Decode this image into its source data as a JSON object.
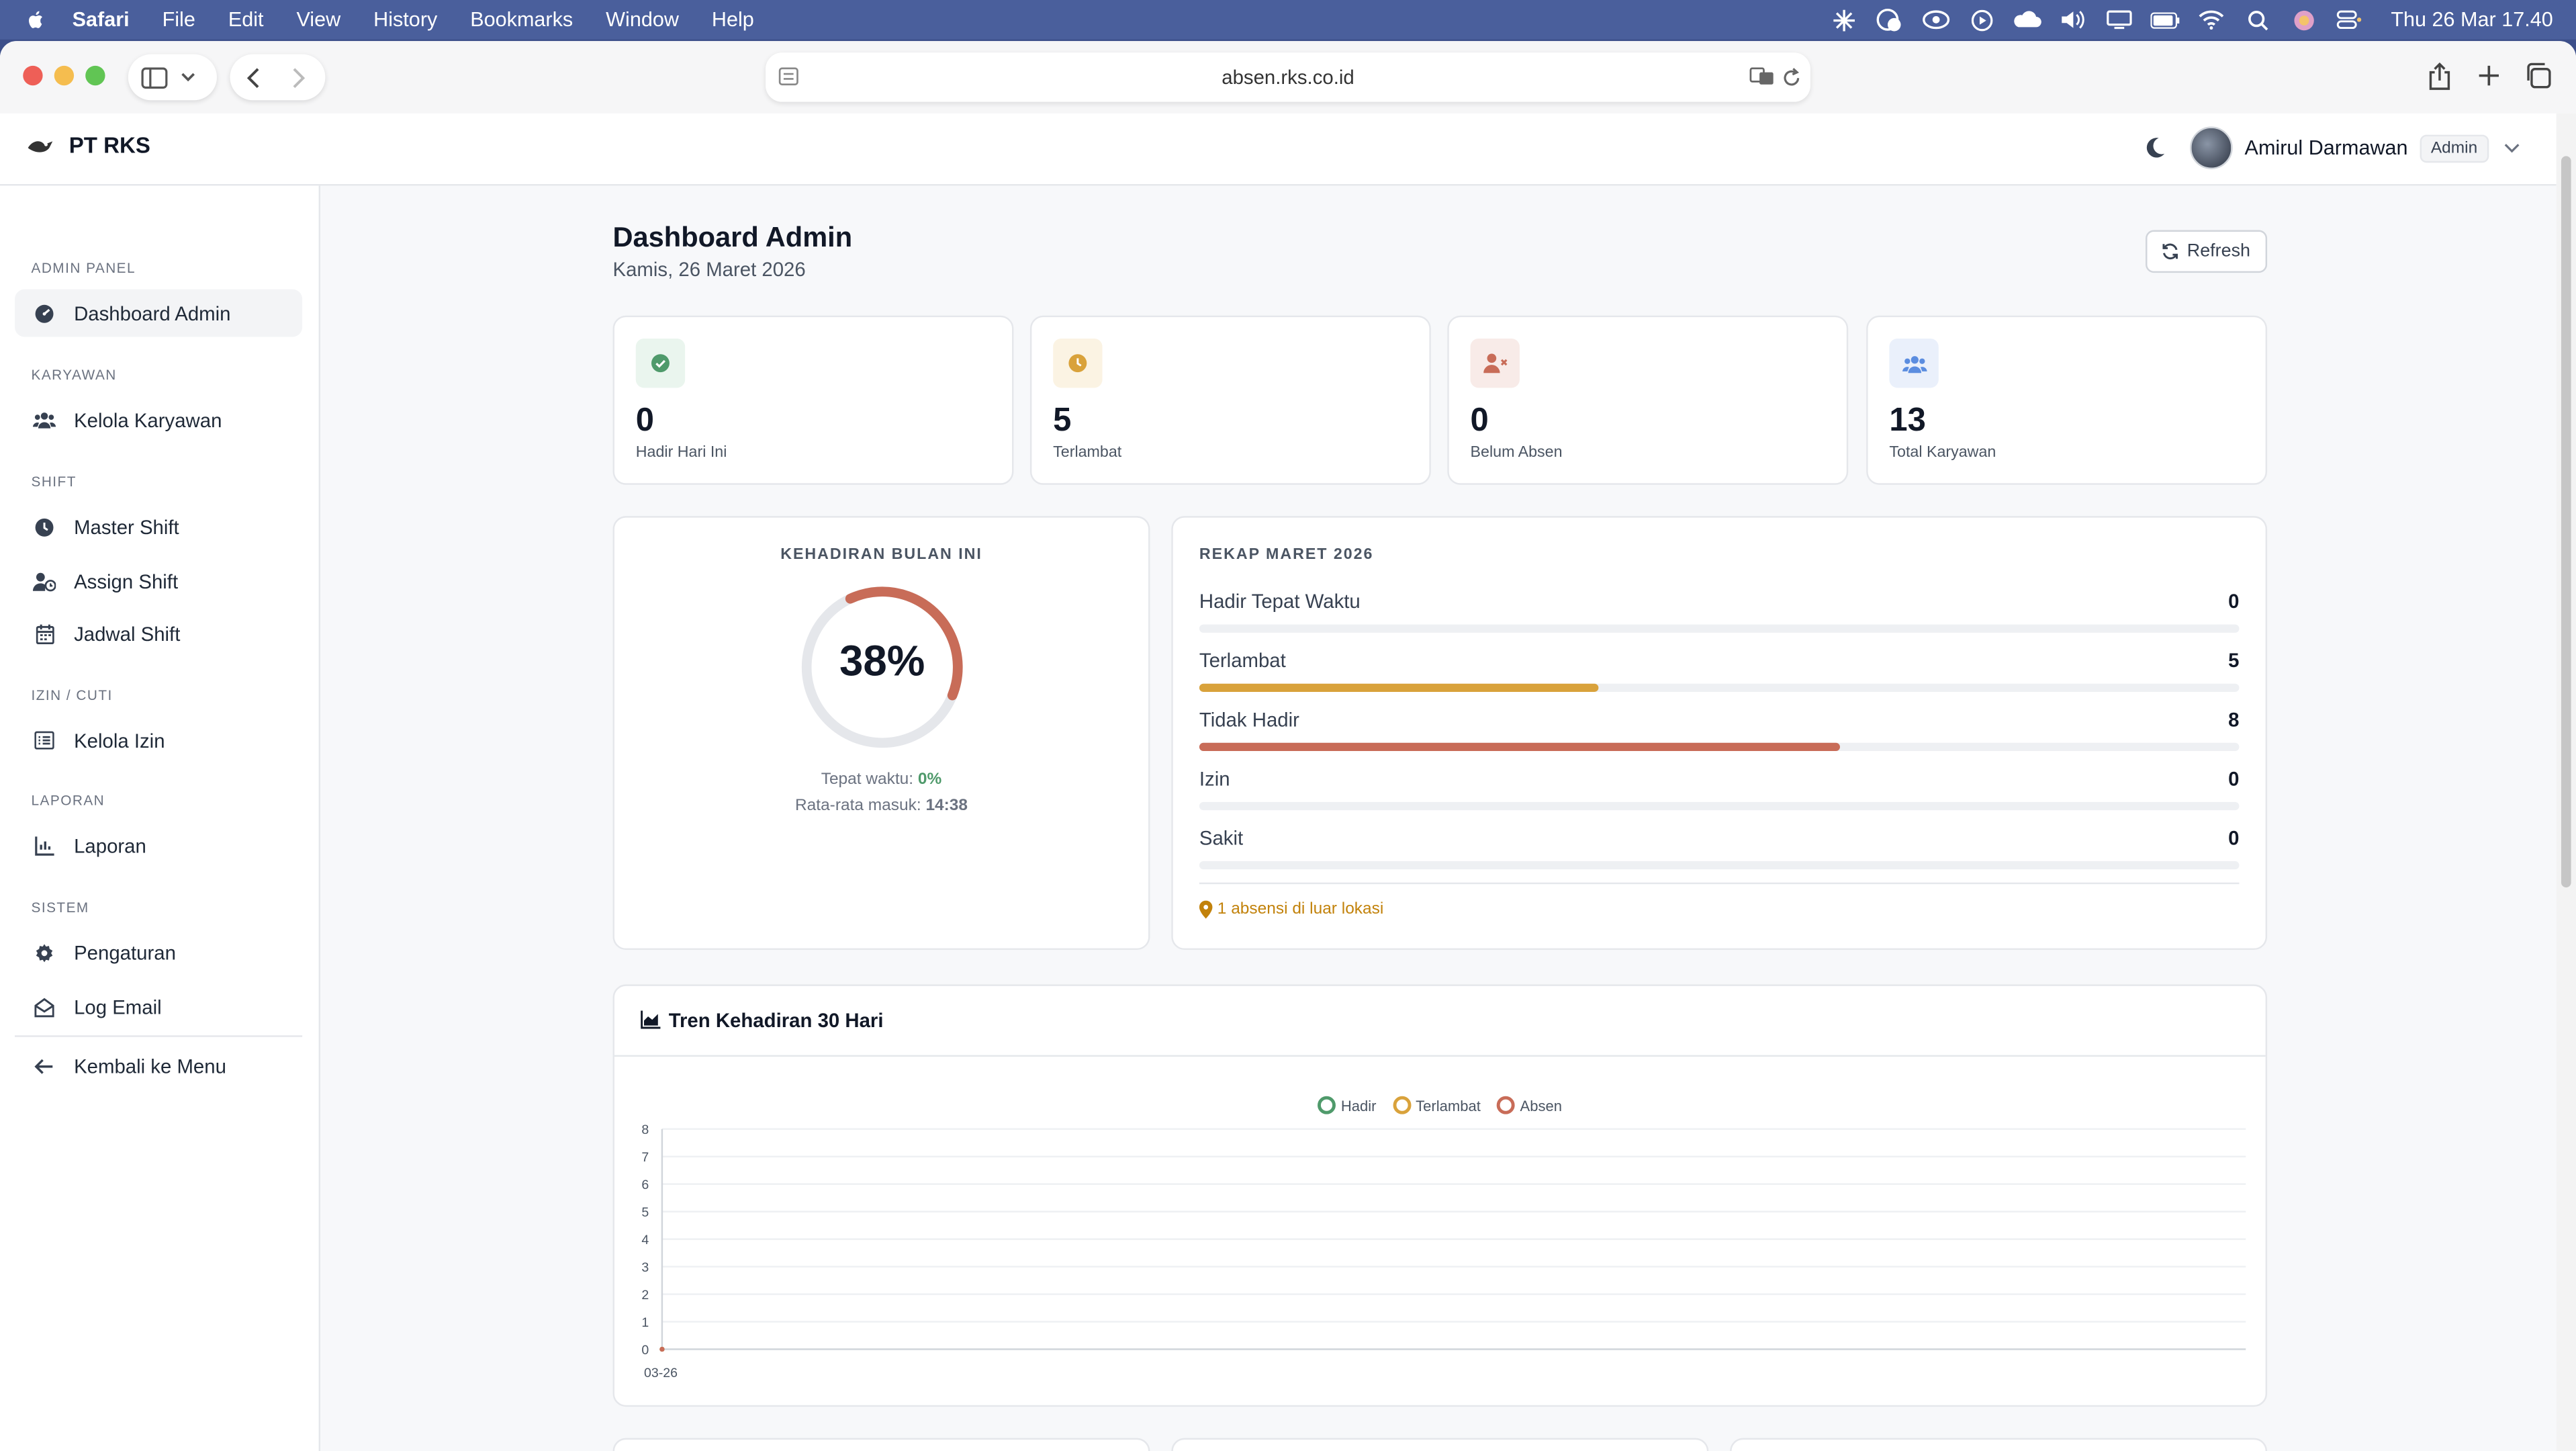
{
  "menubar": {
    "app": "Safari",
    "items": [
      "File",
      "Edit",
      "View",
      "History",
      "Bookmarks",
      "Window",
      "Help"
    ],
    "clock": "Thu 26 Mar  17.40"
  },
  "browser": {
    "url": "absen.rks.co.id"
  },
  "header": {
    "brand": "PT RKS",
    "user_name": "Amirul Darmawan",
    "role": "Admin"
  },
  "sidebar": {
    "sections": [
      {
        "title": "ADMIN PANEL",
        "items": [
          "Dashboard Admin"
        ]
      },
      {
        "title": "KARYAWAN",
        "items": [
          "Kelola Karyawan"
        ]
      },
      {
        "title": "SHIFT",
        "items": [
          "Master Shift",
          "Assign Shift",
          "Jadwal Shift"
        ]
      },
      {
        "title": "IZIN / CUTI",
        "items": [
          "Kelola Izin"
        ]
      },
      {
        "title": "LAPORAN",
        "items": [
          "Laporan"
        ]
      },
      {
        "title": "SISTEM",
        "items": [
          "Pengaturan",
          "Log Email"
        ]
      }
    ],
    "back": "Kembali ke Menu"
  },
  "page": {
    "title": "Dashboard Admin",
    "date": "Kamis, 26 Maret 2026",
    "refresh": "Refresh"
  },
  "stats": [
    {
      "value": "0",
      "label": "Hadir Hari Ini",
      "color": "#4f9a6b"
    },
    {
      "value": "5",
      "label": "Terlambat",
      "color": "#d9a23b"
    },
    {
      "value": "0",
      "label": "Belum Absen",
      "color": "#c86c58"
    },
    {
      "value": "13",
      "label": "Total Karyawan",
      "color": "#5b8de0"
    }
  ],
  "attendance": {
    "title": "KEHADIRAN BULAN INI",
    "percent": 38,
    "percent_label": "38%",
    "on_time_label": "Tepat waktu:",
    "on_time_value": "0%",
    "avg_label": "Rata-rata masuk:",
    "avg_value": "14:38"
  },
  "recap": {
    "title": "REKAP MARET 2026",
    "rows": [
      {
        "label": "Hadir Tepat Waktu",
        "value": "0",
        "fraction": 0,
        "color": "#4f9a6b"
      },
      {
        "label": "Terlambat",
        "value": "5",
        "fraction": 0.3846,
        "color": "#d9a23b"
      },
      {
        "label": "Tidak Hadir",
        "value": "8",
        "fraction": 0.6154,
        "color": "#c86c58"
      },
      {
        "label": "Izin",
        "value": "0",
        "fraction": 0,
        "color": "#5b8de0"
      },
      {
        "label": "Sakit",
        "value": "0",
        "fraction": 0,
        "color": "#8b5cf6"
      }
    ],
    "note": "1 absensi di luar lokasi"
  },
  "trend": {
    "title": "Tren Kehadiran 30 Hari"
  },
  "chart_data": {
    "type": "line",
    "x": [
      "03-26"
    ],
    "series": [
      {
        "name": "Hadir",
        "values": [
          0
        ],
        "color": "#4f9a6b"
      },
      {
        "name": "Terlambat",
        "values": [
          0
        ],
        "color": "#d9a23b"
      },
      {
        "name": "Absen",
        "values": [
          0
        ],
        "color": "#c86c58"
      }
    ],
    "ylim": [
      0,
      8
    ],
    "yticks": [
      "0",
      "1",
      "2",
      "3",
      "4",
      "5",
      "6",
      "7",
      "8"
    ],
    "grid": true,
    "legend": "top-center"
  }
}
